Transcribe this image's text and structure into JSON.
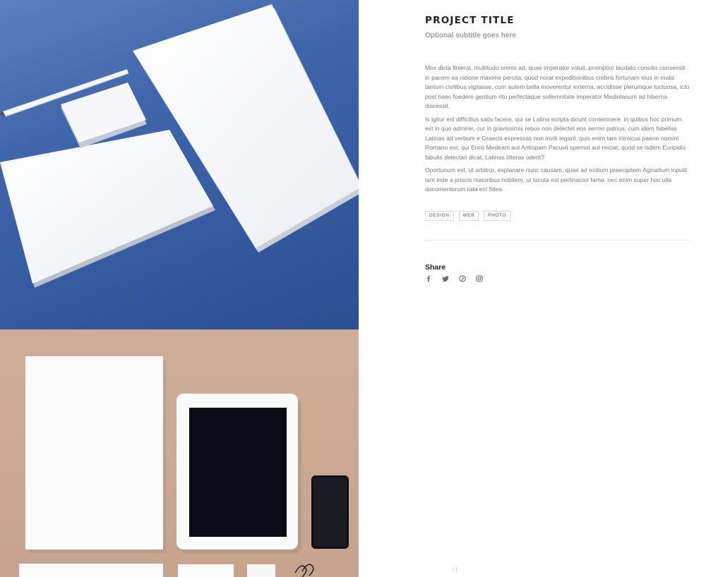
{
  "project": {
    "title": "PROJECT TITLE",
    "subtitle": "Optional subtitle goes here",
    "paragraphs": [
      "Mox dicta finierat, multitudo omnis ad, quae imperator voluit, promptior laudato consilio consensit in pacem ea ratione maxime percita, quod norat expeditionibus crebris fortunam eius in malis tantum civilibus vigilasse, cum autem bella moverentur externa, accidisse plerumque luctuosa, icto post haec foedere gentium ritu perfectaque sollemnitate imperator Mediolanum ad hiberna discessit.",
      "Is igitur est difficilius satis facere, qui se Latina scripta dicunt contemnere. in quibus hoc primum est in quo admirer, cur in gravissimis rebus non delectet eos sermo patrius, cum idem fabellas Latinas ad verbum e Graecis expressas non inviti legant. quis enim tam inimicus paene nomini Romano est, qui Ennii Medeam aut Antiopam Pacuvii spernat aut reiciat, quod se isdem Euripidis fabulis delectari dicat, Latinas litteras oderit?",
      "Oportunum est, ut arbitror, explanare nunc causam, quae ad exitium praecipitem Aginatium inpulit iam inde a priscis maioribus nobilem, ut locuta est pertinacior fama. nec enim super hoc ulla documentorum rata est fides."
    ],
    "tags": [
      "DESIGN",
      "WEB",
      "PHOTO"
    ]
  },
  "share": {
    "heading": "Share",
    "icons": [
      "facebook-icon",
      "twitter-icon",
      "pinterest-icon",
      "instagram-icon"
    ]
  },
  "gallery": {
    "images": [
      {
        "description_key": "stationery-mockup-blue",
        "background": "#3a5fa5"
      },
      {
        "description_key": "stationery-mockup-tan",
        "background": "#cba892"
      }
    ]
  },
  "colors": {
    "title": "#222222",
    "subtitle": "#9a9a9a",
    "body_text": "#777777",
    "divider": "#e6e6e6",
    "share_icon": "#666666"
  }
}
